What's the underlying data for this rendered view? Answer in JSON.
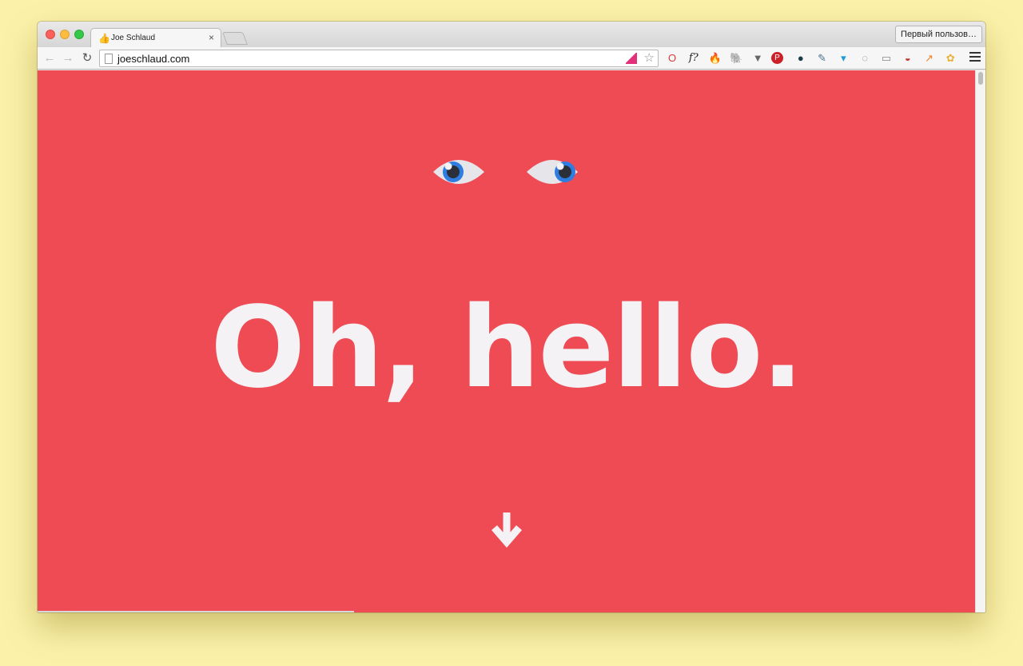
{
  "tab": {
    "title": "Joe Schlaud",
    "close_glyph": "×",
    "favicon_glyph": "👍"
  },
  "profile": {
    "label": "Первый пользов…"
  },
  "nav": {
    "back_glyph": "←",
    "forward_glyph": "→",
    "reload_glyph": "↻"
  },
  "omnibox": {
    "url": "joeschlaud.com",
    "star_glyph": "☆"
  },
  "extensions": [
    {
      "name": "opera-o-icon",
      "glyph": "O",
      "color": "#d93a3a"
    },
    {
      "name": "whatfont-icon",
      "glyph": "f?",
      "color": "#222222"
    },
    {
      "name": "firebug-icon",
      "glyph": "🔥",
      "color": "#e96a10"
    },
    {
      "name": "evernote-icon",
      "glyph": "🐘",
      "color": "#555555"
    },
    {
      "name": "pocket-icon",
      "glyph": "▼",
      "color": "#666666"
    },
    {
      "name": "pinterest-icon",
      "glyph": "P",
      "color": "#cb2027"
    },
    {
      "name": "lens-icon",
      "glyph": "●",
      "color": "#1b3a4a"
    },
    {
      "name": "eyedropper-icon",
      "glyph": "✎",
      "color": "#4a6e8a"
    },
    {
      "name": "gem-icon",
      "glyph": "▾",
      "color": "#1a9ad6"
    },
    {
      "name": "refresh-ext-icon",
      "glyph": "◌",
      "color": "#777777"
    },
    {
      "name": "reader-icon",
      "glyph": "▭",
      "color": "#888888"
    },
    {
      "name": "bowl-icon",
      "glyph": "◒",
      "color": "#c0392b"
    },
    {
      "name": "chart-ext-icon",
      "glyph": "↗",
      "color": "#f0822a"
    },
    {
      "name": "puzzle-ext-icon",
      "glyph": "✿",
      "color": "#e8b23a"
    }
  ],
  "page": {
    "headline": "Oh, hello.",
    "background_color": "#ef4b55",
    "text_color": "#f4f2f4",
    "iris_color": "#2f7de1",
    "pupil_color": "#2a2f3a"
  }
}
